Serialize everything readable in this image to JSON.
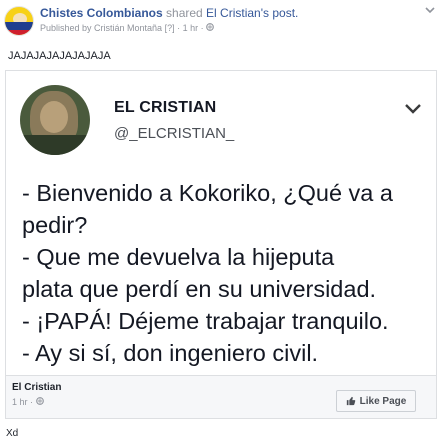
{
  "post": {
    "page_name": "Chistes Colombianos",
    "shared_text": " shared ",
    "origin_link": "El Cristian's post.",
    "published_by": "Published by Cristián Montaña",
    "meta": "[?] · 1 hr · ",
    "text": "JAJAJAJAJAJAJAJA"
  },
  "tweet": {
    "name": "EL CRISTIAN",
    "handle": "@_ELCRISTIAN_",
    "lines": [
      "- Bienvenido a Kokoriko, ¿Qué va a",
      "pedir?",
      "- Que me devuelva la hijeputa",
      "plata que perdí en su universidad.",
      "- ¡PAPÁ! Déjeme trabajar tranquilo.",
      "- Ay si sí, don ingeniero civil."
    ]
  },
  "footer": {
    "name": "El Cristian",
    "time": "1 hr · ",
    "like_label": "Like Page"
  },
  "bottom": {
    "text": "Xd"
  },
  "colors": {
    "link": "#365899",
    "meta": "#90949c"
  },
  "icons": [
    "globe-icon",
    "more-options-icon",
    "chevron-down-icon",
    "thumbs-up-icon"
  ]
}
